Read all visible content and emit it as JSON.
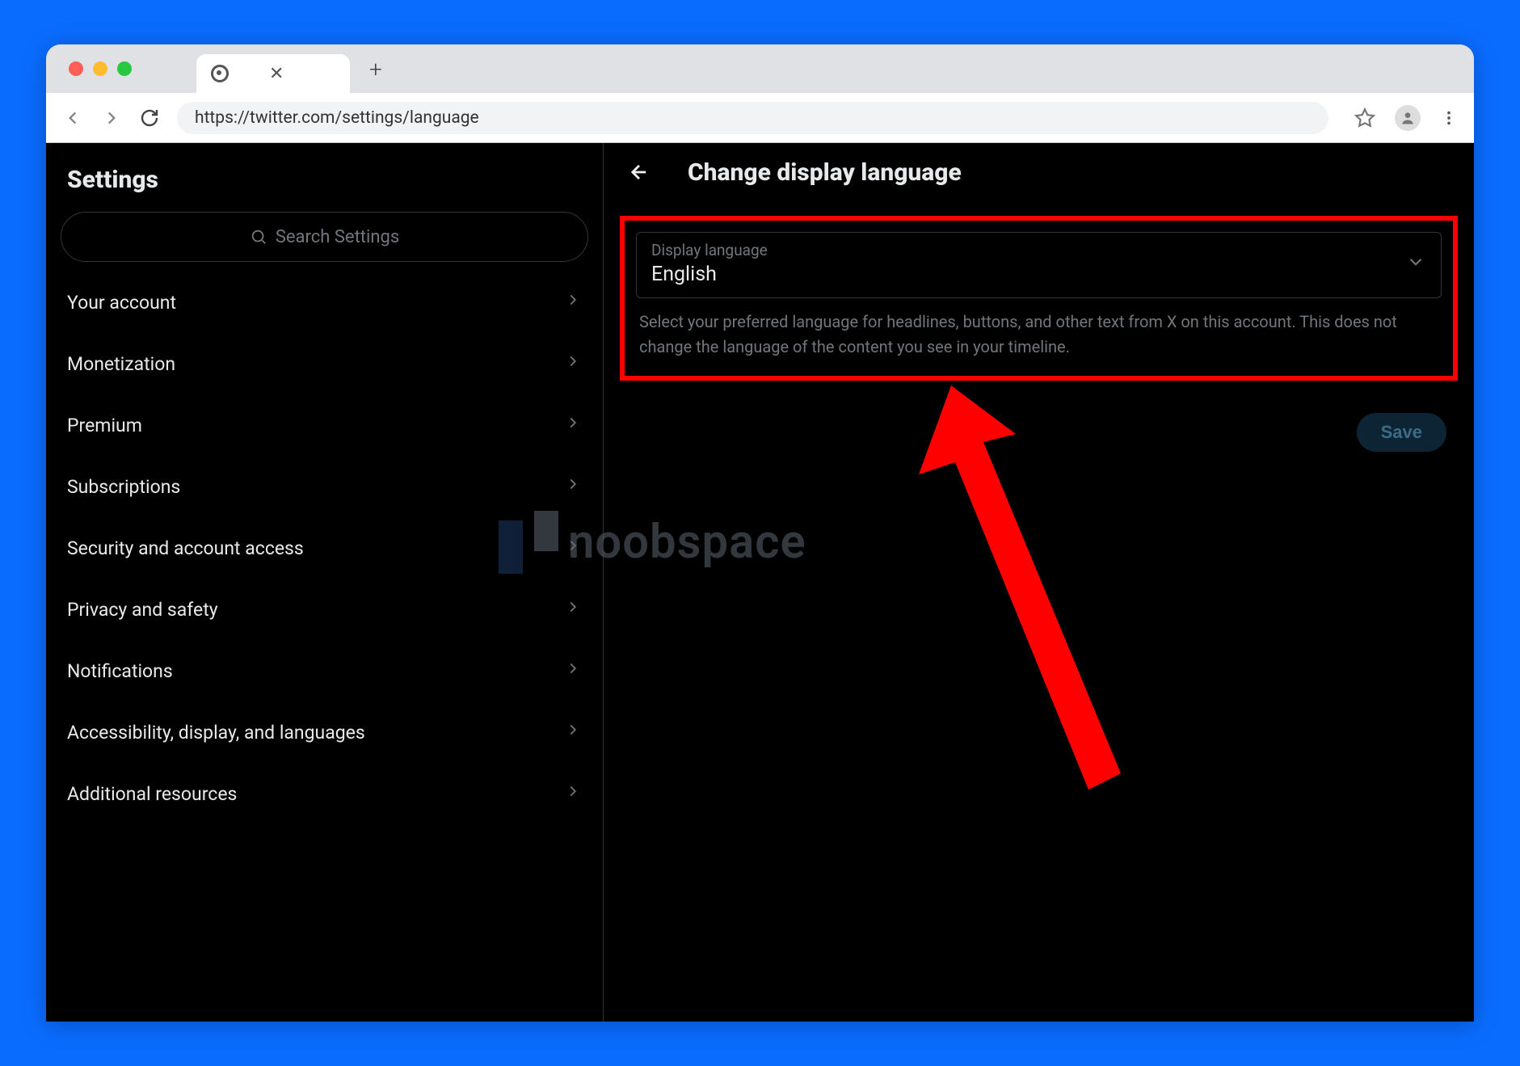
{
  "browser": {
    "url": "https://twitter.com/settings/language"
  },
  "sidebar": {
    "title": "Settings",
    "search_placeholder": "Search Settings",
    "items": [
      {
        "label": "Your account"
      },
      {
        "label": "Monetization"
      },
      {
        "label": "Premium"
      },
      {
        "label": "Subscriptions"
      },
      {
        "label": "Security and account access"
      },
      {
        "label": "Privacy and safety"
      },
      {
        "label": "Notifications"
      },
      {
        "label": "Accessibility, display, and languages"
      },
      {
        "label": "Additional resources"
      }
    ]
  },
  "main": {
    "title": "Change display language",
    "field_label": "Display language",
    "field_value": "English",
    "help_text": "Select your preferred language for headlines, buttons, and other text from X on this account. This does not change the language of the content you see in your timeline.",
    "save_label": "Save"
  },
  "watermark": {
    "text": "noobspace"
  }
}
